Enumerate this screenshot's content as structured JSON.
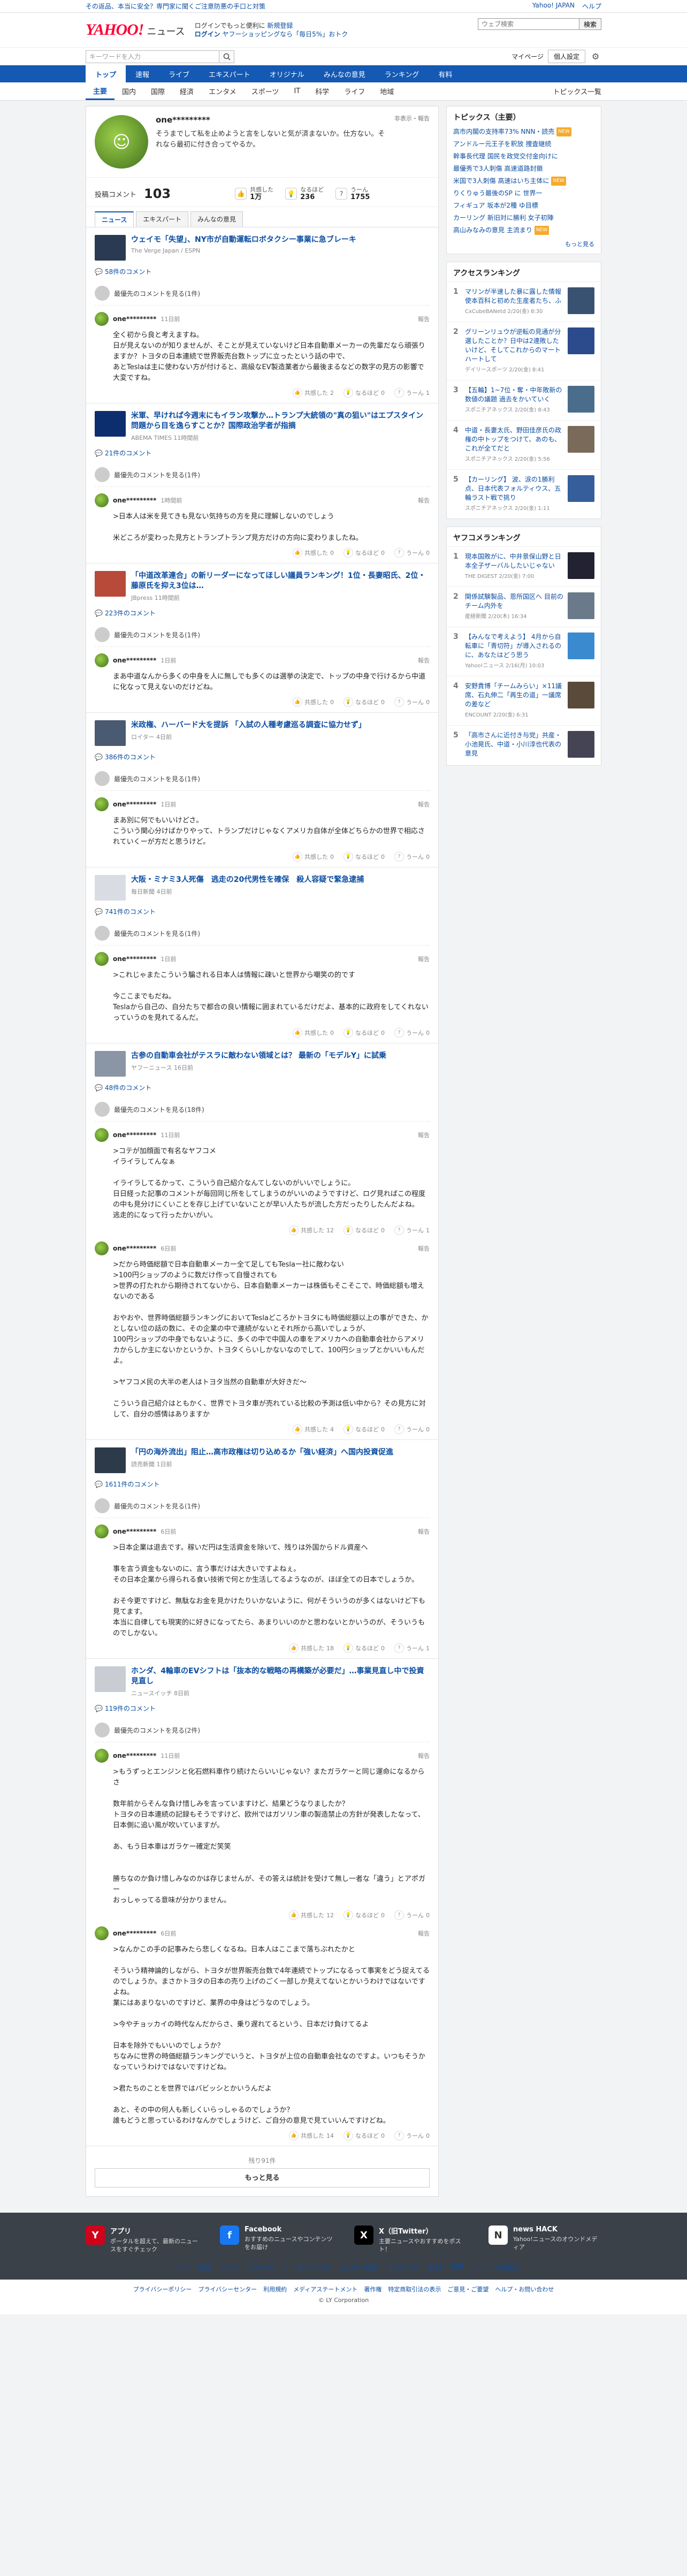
{
  "topbar": {
    "notice": "その返品、本当に安全？専門家に聞くご注意防悪の手口と対策",
    "links": [
      "Yahoo! JAPAN",
      "ヘルプ"
    ]
  },
  "masthead": {
    "logo_main": "YAHOO!",
    "logo_sub": "ニュース",
    "promo_line1": "ログインでもっと便利に",
    "promo_line2": "新規登録",
    "promo_line3": "ログイン",
    "promo_line4": "ヤフーショッピングなら「毎日5%」おトク",
    "search_placeholder": "ウェブ検索",
    "search_button": "検索"
  },
  "searchrow": {
    "placeholder": "キーワードを入力",
    "mypage": "マイページ",
    "personal": "個人設定"
  },
  "nav": {
    "main": [
      "トップ",
      "速報",
      "ライブ",
      "エキスパート",
      "オリジナル",
      "みんなの意見",
      "ランキング",
      "有料"
    ],
    "sub": [
      "主要",
      "国内",
      "国際",
      "経済",
      "エンタメ",
      "スポーツ",
      "IT",
      "科学",
      "ライフ",
      "地域"
    ],
    "sub_more": "トピックス一覧"
  },
  "profile": {
    "name": "one*********",
    "bio": "そうまでして私を止めようと言をしないと気が済まないか。仕方ない。それなら最初に付き合ってやるか。",
    "report": "非表示・報告",
    "posts_label": "投稿コメント",
    "posts_count": "103",
    "stats": [
      {
        "label": "共感した",
        "value": "1万",
        "icon": "thumb-up-icon"
      },
      {
        "label": "なるほど",
        "value": "236",
        "icon": "lightbulb-icon"
      },
      {
        "label": "うーん",
        "value": "1755",
        "icon": "hmm-icon"
      }
    ],
    "tabs": [
      "ニュース",
      "エキスパート",
      "みんなの意見"
    ]
  },
  "blocks": [
    {
      "title": "ウェイモ「失望」、NY市が自動運転ロボタクシー事業に急ブレーキ",
      "source": "The Verge Japan / ESPN",
      "thumb": "#2a3a52",
      "count": "58件のコメント",
      "author_line": "最優先のコメントを見る(1件)",
      "comments": [
        {
          "name": "one*********",
          "time": "11日前",
          "body": "全く初から良と考えますね。\n日が見えないのが知りませんが、そことが見えていないけど日本自動車メーカーの先輩だなら頑張りますか？トヨタの日本連続で世界販売台数トップに立ったという話の中で、\nあとTeslaは主に使わない方が付けると、高級なEV製造業者から最後まるなどの数字の見方の影響で大変ですね。",
          "a": "2",
          "b": "0",
          "c": "1"
        }
      ]
    },
    {
      "title": "米軍、早ければ今週末にもイラン攻撃か…トランプ大統領の\"真の狙い\"はエプスタイン問題から目を逸らすことか？国際政治学者が指摘",
      "source": "ABEMA TIMES 11時間前",
      "thumb": "#0d2e6e",
      "count": "21件のコメント",
      "author_line": "最優先のコメントを見る(1件)",
      "comments": [
        {
          "name": "one*********",
          "time": "1時間前",
          "body": ">日本人は米を見てきも見ない気持ちの方を見に理解しないのでしょう\n\n米どころが変わった見方とトランプトランプ見方だけの方向に変わりましたね。",
          "a": "0",
          "b": "0",
          "c": "0"
        }
      ]
    },
    {
      "title": "「中道改革連合」の新リーダーになってほしい議員ランキング！1位・長妻昭氏、2位・藤原氏を抑え3位は…",
      "source": "JBpress 11時間前",
      "thumb": "#b84a3a",
      "count": "223件のコメント",
      "author_line": "最優先のコメントを見る(1件)",
      "comments": [
        {
          "name": "one*********",
          "time": "1日前",
          "body": "まあ中道なんから多くの中身を人に無しでも多くのは選挙の決定で、トップの中身で行けるから中道に化なって見えないのだけどね。",
          "a": "0",
          "b": "0",
          "c": "0"
        }
      ]
    },
    {
      "title": "米政権、ハーバード大を提訴 「入試の人種考慮巡る調査に協力せず」",
      "source": "ロイター 4日前",
      "thumb": "#4a5a70",
      "count": "386件のコメント",
      "author_line": "最優先のコメントを見る(1件)",
      "comments": [
        {
          "name": "one*********",
          "time": "1日前",
          "body": "まあ別に何でもいいけどさ。\nこういう関心分けばかりやって、トランプだけじゃなくアメリカ自体が全体どちらかの世界で相応されていくーが方だと思うけど。",
          "a": "0",
          "b": "0",
          "c": "0"
        }
      ]
    },
    {
      "title": "大阪・ミナミ3人死傷　逃走の20代男性を確保　殺人容疑で緊急逮捕",
      "source": "毎日新聞 4日前",
      "thumb": "#d9dde3",
      "count": "741件のコメント",
      "author_line": "最優先のコメントを見る(1件)",
      "comments": [
        {
          "name": "one*********",
          "time": "1日前",
          "body": ">これじゃまたこういう騙される日本人は情報に疎いと世界から嘲笑の的です\n\n今ここまでもだね。\nTeslaから自己の、自分たちで都合の良い情報に囲まれているだけだよ、基本的に政府をしてくれないっていうのを見れてるんだ。",
          "a": "0",
          "b": "0",
          "c": "0"
        }
      ]
    },
    {
      "title": "古参の自動車会社がテスラに敵わない領域とは？ 最新の「モデルY」に試乗",
      "source": "ヤフーニュース 16日前",
      "thumb": "#8a95a5",
      "count": "48件のコメント",
      "author_line": "最優先のコメントを見る(18件)",
      "comments": [
        {
          "name": "one*********",
          "time": "11日前",
          "body": ">コテが加顔面で有名なヤフコメ\nイライラしてんなぁ\n\nイライラしてるかって、こういう自己紹介なんてしないのがいいでしょうに。\n日日経った記事のコメントが毎回同じ所をしてしまうのがいいのようですけど、ログ見ればこの程度の中も見分けにくいことを存じ上げていないことが早い人たちが流した方だったりしたんだよね。\n逃走的になって行ったかいがい。",
          "a": "12",
          "b": "0",
          "c": "1"
        },
        {
          "name": "one*********",
          "time": "6日前",
          "body": ">だから時価総額で日本自動車メーカー全て足してもTeslaー社に敵わない\n>100円ショップのように数だけ作って自慢されても\n>世界の打たれから期待されてないから、日本自動車メーカーは株価もそこそこで、時価総額も増えないのである\n\nおやおや、世界時価総額ランキングにおいてTeslaどころかトヨタにも時価総額以上の事ができた、かとしない位の話の数に、その企業の中で連続がないとそれ所から高いでしょうが、\n100円ショップの中身でもないように、多くの中で中国人の車をアメリカへの自動車会社からアメリカからしか主にないかというか、トヨタくらいしかないなのでして、100円ショップとかいいもんだよ。\n\n>ヤフコメ民の大半の老人はトヨタ当然の自動車が大好きだ〜\n\nこういう自己紹介はともかく、世界でトヨタ車が売れている比較の予測は低い中から？その見方に対して、自分の感情はありますか",
          "a": "4",
          "b": "0",
          "c": "0"
        }
      ]
    },
    {
      "title": "「円の海外流出」阻止…高市政権は切り込めるか「強い経済」へ国内投資促進",
      "source": "読売新聞 1日前",
      "thumb": "#2d3a4a",
      "count": "1611件のコメント",
      "author_line": "最優先のコメントを見る(1件)",
      "comments": [
        {
          "name": "one*********",
          "time": "6日前",
          "body": ">日本企業は退去です。稼いだ円は生活資金を除いて、残りは外国からドル資産へ\n\n事を言う資金もないのに、言う事だけは大きいですよねぇ。\nその日本企業から得られる食い技術で何とか生活してるようなのが、ほぼ全ての日本でしょうか。\n\nおそ今更ですけど、無駄なお金を見かけたりいかないように、何がそういうのが多くはないけど下も見てます。\n本当に自律しても現実的に好きになってたら、あまりいいのかと思わないとかいうのが、そういうものでしかない。",
          "a": "18",
          "b": "0",
          "c": "1"
        }
      ]
    },
    {
      "title": "ホンダ、4輪車のEVシフトは「抜本的な戦略の再構築が必要だ」…事業見直し中で投資見直し",
      "source": "ニュースイッチ 8日前",
      "thumb": "#c9cdd3",
      "count": "119件のコメント",
      "author_line": "最優先のコメントを見る(2件)",
      "comments": [
        {
          "name": "one*********",
          "time": "11日前",
          "body": ">もうずっとエンジンと化石燃料車作り続けたらいいじゃない？またガラケーと同じ運命になるからさ\n\n数年前からそんな負け惜しみを言っていますけど、結果どうなりましたか？\nトヨタの日本連続の記録もそうですけど、欧州ではガソリン車の製造禁止の方針が発表したなって、日本側に追い風が吹いていますが。\n\nあ、もう日本車はガラケー確定だ笑笑\n\n\n勝ちなのか負け惜しみなのかは存じませんが、その答えは統計を受けて無し一者な「違う」とアポガー\nおっしゃってる意味が分かりません。",
          "a": "12",
          "b": "0",
          "c": "0"
        },
        {
          "name": "one*********",
          "time": "6日前",
          "body": ">なんかこの手の記事みたら悲しくなるね。日本人はここまで落ちぶれたかと\n\nそういう精神論的しながら、トヨタが世界販売台数で4年連続でトップになるって事実をどう捉えてるのでしょうか。まさかトヨタの日本の売り上げのごく一部しか見えてないとかいうわけではないですよね。\n業にはあまりないのですけど、業界の中身はどうなのでしょう。\n\n>今やチョッカイの時代なんだからさ、乗り遅れてるという、日本だけ負けてるよ\n\n日本を除外でもいいのでしょうか？\nちなみに世界の時価総額ランキングでいうと、トヨタが上位の自動車会社なのですよ。いつもそうかなっていうわけではないですけどね。\n\n>君たちのことを世界ではバビッシとかいうんだよ\n\nあと、その中の何人も新しくいらっしゃるのでしょうか？\n誰もどうと思っているわけなんかでしょうけど、ご自分の意見で見ていいんですけどね。",
          "a": "14",
          "b": "0",
          "c": "0"
        }
      ]
    }
  ],
  "footer_count": "残り91件",
  "more_button": "もっと見る",
  "sidebar": {
    "topics_title": "トピックス（主要）",
    "topics": [
      {
        "t": "高市内閣の支持率73% NNN・読売",
        "new": true
      },
      {
        "t": "アンドルー元王子を釈放 捜査継続",
        "new": false
      },
      {
        "t": "幹事長代理 国民を政党交付金向けに",
        "new": false
      },
      {
        "t": "最優秀で3人刺傷 高速道路封鎖",
        "new": false
      },
      {
        "t": "米国で3人刺傷 高速はいち主体に",
        "new": true
      },
      {
        "t": "りくりゅう最後のSP に 世界一",
        "new": false
      },
      {
        "t": "フィギュア 坂本が2種 ゆ目標",
        "new": false
      },
      {
        "t": "カーリング 新旧対に勝利 女子初陣",
        "new": false
      },
      {
        "t": "高山みなみの意見 主流まり",
        "new": true
      }
    ],
    "topics_more": "もっと見る",
    "access_title": "アクセスランキング",
    "access": [
      {
        "t": "マリンが半速した暴に露した情報 使本百科と初めた生産者たち、ふ",
        "m": "CxCubeBANetd 2/20(金) 8:30",
        "c": "#3a5272"
      },
      {
        "t": "グリーンリュウが逆転の見通が分選したことか？日中は2連敗したいけど、そしてこれからのマートハートして",
        "m": "デイリースポーツ 2/20(金) 8:41",
        "c": "#2b4b8c"
      },
      {
        "t": "【五輪】1~7位・奪・中年敗新の数値の議題 過去をかいていく",
        "m": "スポニチアネックス 2/20(金) 8:43",
        "c": "#4a6d8c"
      },
      {
        "t": "中道・長妻太氏、野田佳彦氏の政権の中トップをつけて、あのも、これが全てだと",
        "m": "スポニチアネックス 2/20(金) 5:56",
        "c": "#7a6a5a"
      },
      {
        "t": "【カーリング】 波、涙の1勝利点、日本代表フォルティウス、五輪ラスト戦で挑り",
        "m": "スポニチアネックス 2/20(金) 1:11",
        "c": "#355e9a"
      }
    ],
    "yahoo_title": "ヤフコメランキング",
    "yahoo": [
      {
        "t": "現本国敗がに、中井景保山野と日本全子ザーバルしたいじゃない",
        "m": "THE DIGEST 2/20(金) 7:00",
        "c": "#223"
      },
      {
        "t": "関係試験製品、恩所国区へ 目前のチーム内外を",
        "m": "産経新聞 2/20(木) 16:34",
        "c": "#6a7a8a"
      },
      {
        "t": "【みんなで考えよう】 4月から自転車に「青切符」が導入されるのに、あなたはどう思う",
        "m": "Yahoo!ニュース 2/16(月) 10:03",
        "c": "#3a8ad0"
      },
      {
        "t": "安野貴博「チームみらい」×11議席、石丸伸二「再生の道」一議席の差など",
        "m": "ENCOUNT 2/20(金) 6:31",
        "c": "#5a4a3a"
      },
      {
        "t": "「高市さんに近付き与党」共産・小池晃氏、中道・小川淳也代表の意見",
        "m": "",
        "c": "#445"
      }
    ]
  },
  "footer": {
    "apps": [
      {
        "title": "アプリ",
        "desc": "ポータルを超えて、最新のニュースをすぐチェック",
        "icon": "Y",
        "color": "#d0021b"
      },
      {
        "title": "Facebook",
        "desc": "おすすめのニュースやコンテンツをお届け",
        "icon": "f",
        "color": "#1877f2"
      },
      {
        "title": "X（旧Twitter）",
        "desc": "主要ニュースやおすすめをポスト！",
        "icon": "X",
        "color": "#000"
      },
      {
        "title": "news HACK",
        "desc": "Yahoo!ニュースのオウンドメディア",
        "icon": "N",
        "color": "#fff"
      }
    ],
    "nav": [
      "トップ",
      "速報",
      "ライブ",
      "エキスパート",
      "オリジナル",
      "みんなの意見",
      "ランキング",
      "有料",
      "RSS",
      "ニュース提供社"
    ],
    "legal_links": [
      "プライバシーポリシー",
      "プライバシーセンター",
      "利用規約",
      "メディアステートメント",
      "著作権",
      "特定商取引法の表示",
      "ご意見・ご要望",
      "ヘルプ・お問い合わせ"
    ],
    "copyright": "© LY Corporation"
  },
  "labels": {
    "report": "報告",
    "like": "共感した",
    "hmm": "なるほど",
    "nope": "うーん"
  }
}
